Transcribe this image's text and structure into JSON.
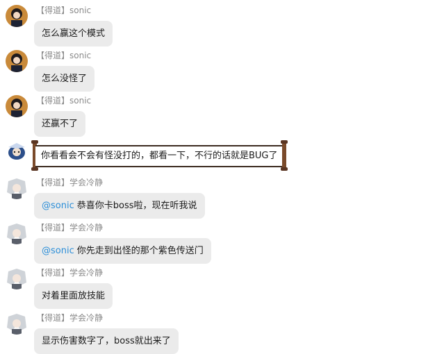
{
  "messages": [
    {
      "sender": "【得道】sonic",
      "text": "怎么赢这个模式",
      "avatar": "dark-hair-avatar"
    },
    {
      "sender": "【得道】sonic",
      "text": "怎么没怪了",
      "avatar": "dark-hair-avatar"
    },
    {
      "sender": "【得道】sonic",
      "text": "还赢不了",
      "avatar": "dark-hair-avatar"
    },
    {
      "sender": "",
      "text": "你看看会不会有怪没打的，都看一下，不行的话就是BUG了",
      "avatar": "blue-character-avatar",
      "style": "scroll"
    },
    {
      "sender": "【得道】学会冷静",
      "mention": "@sonic",
      "text": "恭喜你卡boss啦，现在听我说",
      "avatar": "silver-hair-avatar"
    },
    {
      "sender": "【得道】学会冷静",
      "mention": "@sonic",
      "text": "你先走到出怪的那个紫色传送门",
      "avatar": "silver-hair-avatar"
    },
    {
      "sender": "【得道】学会冷静",
      "text": "对着里面放技能",
      "avatar": "silver-hair-avatar"
    },
    {
      "sender": "【得道】学会冷静",
      "text": "显示伤害数字了，boss就出来了",
      "avatar": "silver-hair-avatar"
    }
  ],
  "colors": {
    "bubble": "#ebebeb",
    "mention": "#2b8ed8",
    "name": "#8a8a8a"
  }
}
